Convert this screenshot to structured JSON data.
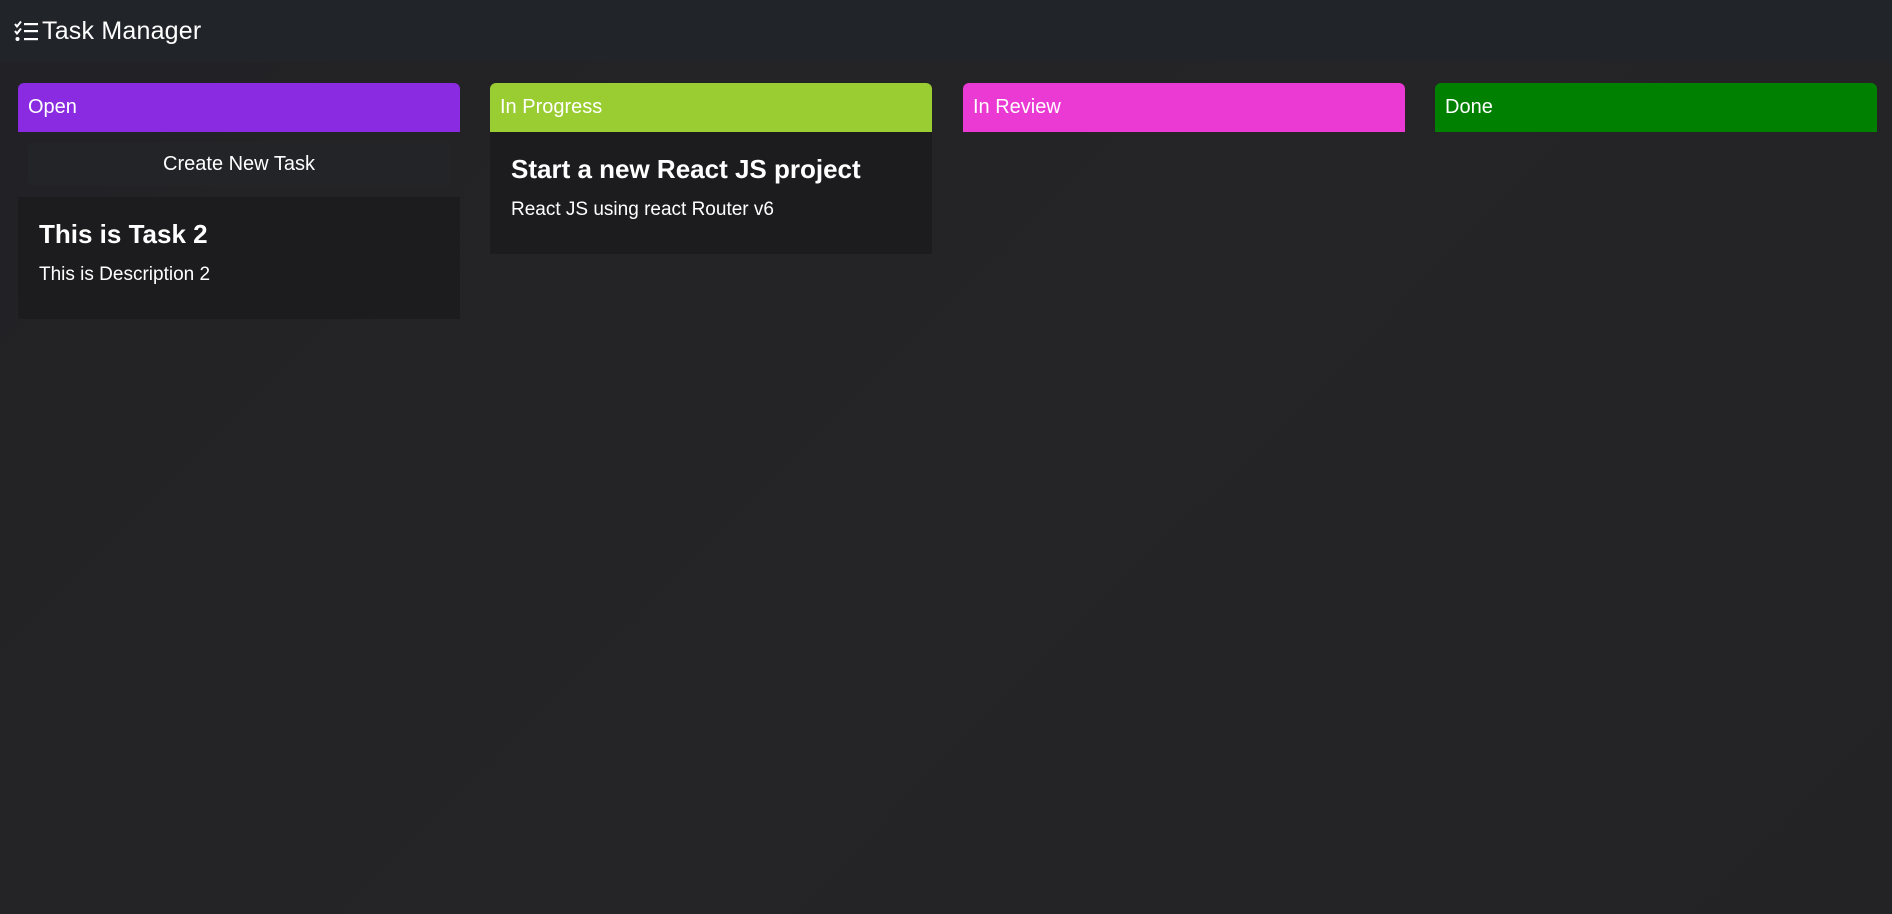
{
  "app": {
    "title": "Task Manager",
    "icon": "checklist-icon"
  },
  "columns": [
    {
      "title": "Open",
      "color": "#8a2be2",
      "create_label": "Create New Task",
      "tasks": [
        {
          "title": "This is Task 2",
          "description": "This is Description 2"
        }
      ]
    },
    {
      "title": "In Progress",
      "color": "#9acd32",
      "tasks": [
        {
          "title": "Start a new React JS project",
          "description": "React JS using react Router v6"
        }
      ]
    },
    {
      "title": "In Review",
      "color": "#ea3ad3",
      "tasks": []
    },
    {
      "title": "Done",
      "color": "#008000",
      "tasks": []
    }
  ]
}
